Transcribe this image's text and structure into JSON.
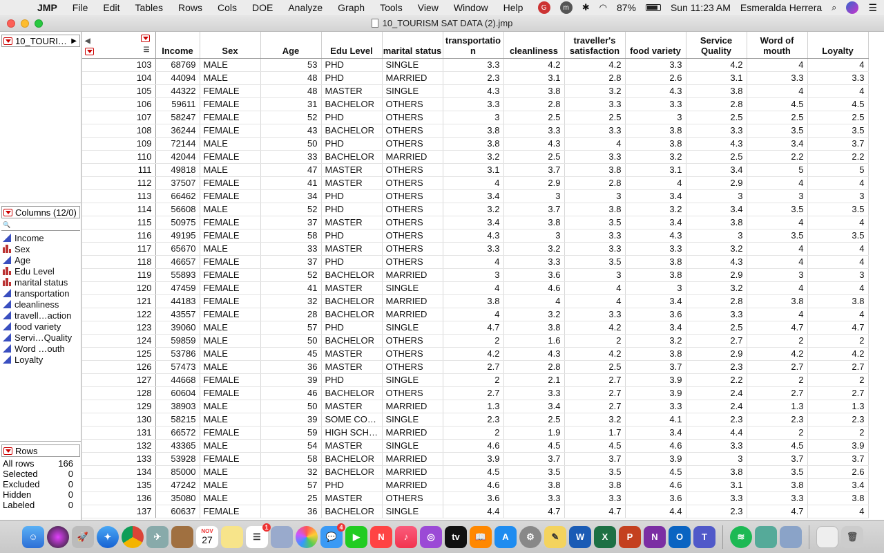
{
  "menubar": {
    "app": "JMP",
    "items": [
      "File",
      "Edit",
      "Tables",
      "Rows",
      "Cols",
      "DOE",
      "Analyze",
      "Graph",
      "Tools",
      "View",
      "Window",
      "Help"
    ],
    "battery": "87%",
    "clock": "Sun 11:23 AM",
    "user": "Esmeralda Herrera"
  },
  "window": {
    "title": "10_TOURISM SAT DATA (2).jmp"
  },
  "table_panel": {
    "name": "10_TOURI…"
  },
  "columns_panel": {
    "header": "Columns (12/0)",
    "search_glyph": "🔍",
    "items": [
      {
        "label": "Income",
        "type": "continuous"
      },
      {
        "label": "Sex",
        "type": "nominal"
      },
      {
        "label": "Age",
        "type": "continuous"
      },
      {
        "label": "Edu Level",
        "type": "nominal"
      },
      {
        "label": "marital status",
        "type": "nominal"
      },
      {
        "label": "transportation",
        "type": "continuous"
      },
      {
        "label": "cleanliness",
        "type": "continuous"
      },
      {
        "label": "travell…action",
        "type": "continuous"
      },
      {
        "label": "food variety",
        "type": "continuous"
      },
      {
        "label": "Servi…Quality",
        "type": "continuous"
      },
      {
        "label": "Word …outh",
        "type": "continuous"
      },
      {
        "label": "Loyalty",
        "type": "continuous"
      }
    ]
  },
  "rows_panel": {
    "header": "Rows",
    "stats": [
      {
        "label": "All rows",
        "value": "166"
      },
      {
        "label": "Selected",
        "value": "0"
      },
      {
        "label": "Excluded",
        "value": "0"
      },
      {
        "label": "Hidden",
        "value": "0"
      },
      {
        "label": "Labeled",
        "value": "0"
      }
    ]
  },
  "grid": {
    "headers": [
      "Income",
      "Sex",
      "Age",
      "Edu Level",
      "marital status",
      "transportatio n",
      "cleanliness",
      "traveller's satisfaction",
      "food variety",
      "Service Quality",
      "Word of mouth",
      "Loyalty"
    ],
    "rows": [
      [
        "103",
        "68769",
        "MALE",
        "53",
        "PHD",
        "SINGLE",
        "3.3",
        "4.2",
        "4.2",
        "3.3",
        "4.2",
        "4",
        "4"
      ],
      [
        "104",
        "44094",
        "MALE",
        "48",
        "PHD",
        "MARRIED",
        "2.3",
        "3.1",
        "2.8",
        "2.6",
        "3.1",
        "3.3",
        "3.3"
      ],
      [
        "105",
        "44322",
        "FEMALE",
        "48",
        "MASTER",
        "SINGLE",
        "4.3",
        "3.8",
        "3.2",
        "4.3",
        "3.8",
        "4",
        "4"
      ],
      [
        "106",
        "59611",
        "FEMALE",
        "31",
        "BACHELOR",
        "OTHERS",
        "3.3",
        "2.8",
        "3.3",
        "3.3",
        "2.8",
        "4.5",
        "4.5"
      ],
      [
        "107",
        "58247",
        "FEMALE",
        "52",
        "PHD",
        "OTHERS",
        "3",
        "2.5",
        "2.5",
        "3",
        "2.5",
        "2.5",
        "2.5"
      ],
      [
        "108",
        "36244",
        "FEMALE",
        "43",
        "BACHELOR",
        "OTHERS",
        "3.8",
        "3.3",
        "3.3",
        "3.8",
        "3.3",
        "3.5",
        "3.5"
      ],
      [
        "109",
        "72144",
        "MALE",
        "50",
        "PHD",
        "OTHERS",
        "3.8",
        "4.3",
        "4",
        "3.8",
        "4.3",
        "3.4",
        "3.7"
      ],
      [
        "110",
        "42044",
        "FEMALE",
        "33",
        "BACHELOR",
        "MARRIED",
        "3.2",
        "2.5",
        "3.3",
        "3.2",
        "2.5",
        "2.2",
        "2.2"
      ],
      [
        "111",
        "49818",
        "MALE",
        "47",
        "MASTER",
        "OTHERS",
        "3.1",
        "3.7",
        "3.8",
        "3.1",
        "3.4",
        "5",
        "5"
      ],
      [
        "112",
        "37507",
        "FEMALE",
        "41",
        "MASTER",
        "OTHERS",
        "4",
        "2.9",
        "2.8",
        "4",
        "2.9",
        "4",
        "4"
      ],
      [
        "113",
        "66462",
        "FEMALE",
        "34",
        "PHD",
        "OTHERS",
        "3.4",
        "3",
        "3",
        "3.4",
        "3",
        "3",
        "3"
      ],
      [
        "114",
        "56608",
        "MALE",
        "52",
        "PHD",
        "OTHERS",
        "3.2",
        "3.7",
        "3.8",
        "3.2",
        "3.4",
        "3.5",
        "3.5"
      ],
      [
        "115",
        "50975",
        "FEMALE",
        "37",
        "MASTER",
        "OTHERS",
        "3.4",
        "3.8",
        "3.5",
        "3.4",
        "3.8",
        "4",
        "4"
      ],
      [
        "116",
        "49195",
        "FEMALE",
        "58",
        "PHD",
        "OTHERS",
        "4.3",
        "3",
        "3.3",
        "4.3",
        "3",
        "3.5",
        "3.5"
      ],
      [
        "117",
        "65670",
        "MALE",
        "33",
        "MASTER",
        "OTHERS",
        "3.3",
        "3.2",
        "3.3",
        "3.3",
        "3.2",
        "4",
        "4"
      ],
      [
        "118",
        "46657",
        "FEMALE",
        "37",
        "PHD",
        "OTHERS",
        "4",
        "3.3",
        "3.5",
        "3.8",
        "4.3",
        "4",
        "4"
      ],
      [
        "119",
        "55893",
        "FEMALE",
        "52",
        "BACHELOR",
        "MARRIED",
        "3",
        "3.6",
        "3",
        "3.8",
        "2.9",
        "3",
        "3"
      ],
      [
        "120",
        "47459",
        "FEMALE",
        "41",
        "MASTER",
        "SINGLE",
        "4",
        "4.6",
        "4",
        "3",
        "3.2",
        "4",
        "4"
      ],
      [
        "121",
        "44183",
        "FEMALE",
        "32",
        "BACHELOR",
        "MARRIED",
        "3.8",
        "4",
        "4",
        "3.4",
        "2.8",
        "3.8",
        "3.8"
      ],
      [
        "122",
        "43557",
        "FEMALE",
        "28",
        "BACHELOR",
        "MARRIED",
        "4",
        "3.2",
        "3.3",
        "3.6",
        "3.3",
        "4",
        "4"
      ],
      [
        "123",
        "39060",
        "MALE",
        "57",
        "PHD",
        "SINGLE",
        "4.7",
        "3.8",
        "4.2",
        "3.4",
        "2.5",
        "4.7",
        "4.7"
      ],
      [
        "124",
        "59859",
        "MALE",
        "50",
        "BACHELOR",
        "OTHERS",
        "2",
        "1.6",
        "2",
        "3.2",
        "2.7",
        "2",
        "2"
      ],
      [
        "125",
        "53786",
        "MALE",
        "45",
        "MASTER",
        "OTHERS",
        "4.2",
        "4.3",
        "4.2",
        "3.8",
        "2.9",
        "4.2",
        "4.2"
      ],
      [
        "126",
        "57473",
        "MALE",
        "36",
        "MASTER",
        "OTHERS",
        "2.7",
        "2.8",
        "2.5",
        "3.7",
        "2.3",
        "2.7",
        "2.7"
      ],
      [
        "127",
        "44668",
        "FEMALE",
        "39",
        "PHD",
        "SINGLE",
        "2",
        "2.1",
        "2.7",
        "3.9",
        "2.2",
        "2",
        "2"
      ],
      [
        "128",
        "60604",
        "FEMALE",
        "46",
        "BACHELOR",
        "OTHERS",
        "2.7",
        "3.3",
        "2.7",
        "3.9",
        "2.4",
        "2.7",
        "2.7"
      ],
      [
        "129",
        "38903",
        "MALE",
        "50",
        "MASTER",
        "MARRIED",
        "1.3",
        "3.4",
        "2.7",
        "3.3",
        "2.4",
        "1.3",
        "1.3"
      ],
      [
        "130",
        "58215",
        "MALE",
        "39",
        "SOME CO…",
        "SINGLE",
        "2.3",
        "2.5",
        "3.2",
        "4.1",
        "2.3",
        "2.3",
        "2.3"
      ],
      [
        "131",
        "66572",
        "FEMALE",
        "59",
        "HIGH SCH…",
        "MARRIED",
        "2",
        "1.9",
        "1.7",
        "3.4",
        "4.4",
        "2",
        "2"
      ],
      [
        "132",
        "43365",
        "MALE",
        "54",
        "MASTER",
        "SINGLE",
        "4.6",
        "4.5",
        "4.5",
        "4.6",
        "3.3",
        "4.5",
        "3.9"
      ],
      [
        "133",
        "53928",
        "FEMALE",
        "58",
        "BACHELOR",
        "MARRIED",
        "3.9",
        "3.7",
        "3.7",
        "3.9",
        "3",
        "3.7",
        "3.7"
      ],
      [
        "134",
        "85000",
        "MALE",
        "32",
        "BACHELOR",
        "MARRIED",
        "4.5",
        "3.5",
        "3.5",
        "4.5",
        "3.8",
        "3.5",
        "2.6"
      ],
      [
        "135",
        "47242",
        "MALE",
        "57",
        "PHD",
        "MARRIED",
        "4.6",
        "3.8",
        "3.8",
        "4.6",
        "3.1",
        "3.8",
        "3.4"
      ],
      [
        "136",
        "35080",
        "MALE",
        "25",
        "MASTER",
        "OTHERS",
        "3.6",
        "3.3",
        "3.3",
        "3.6",
        "3.3",
        "3.3",
        "3.8"
      ],
      [
        "137",
        "60637",
        "FEMALE",
        "36",
        "BACHELOR",
        "SINGLE",
        "4.4",
        "4.7",
        "4.7",
        "4.4",
        "2.3",
        "4.7",
        "4"
      ]
    ]
  },
  "dock": {
    "calendar_day": "27",
    "calendar_month": "NOV",
    "reminders_badge": "1",
    "messages_badge": "4"
  }
}
